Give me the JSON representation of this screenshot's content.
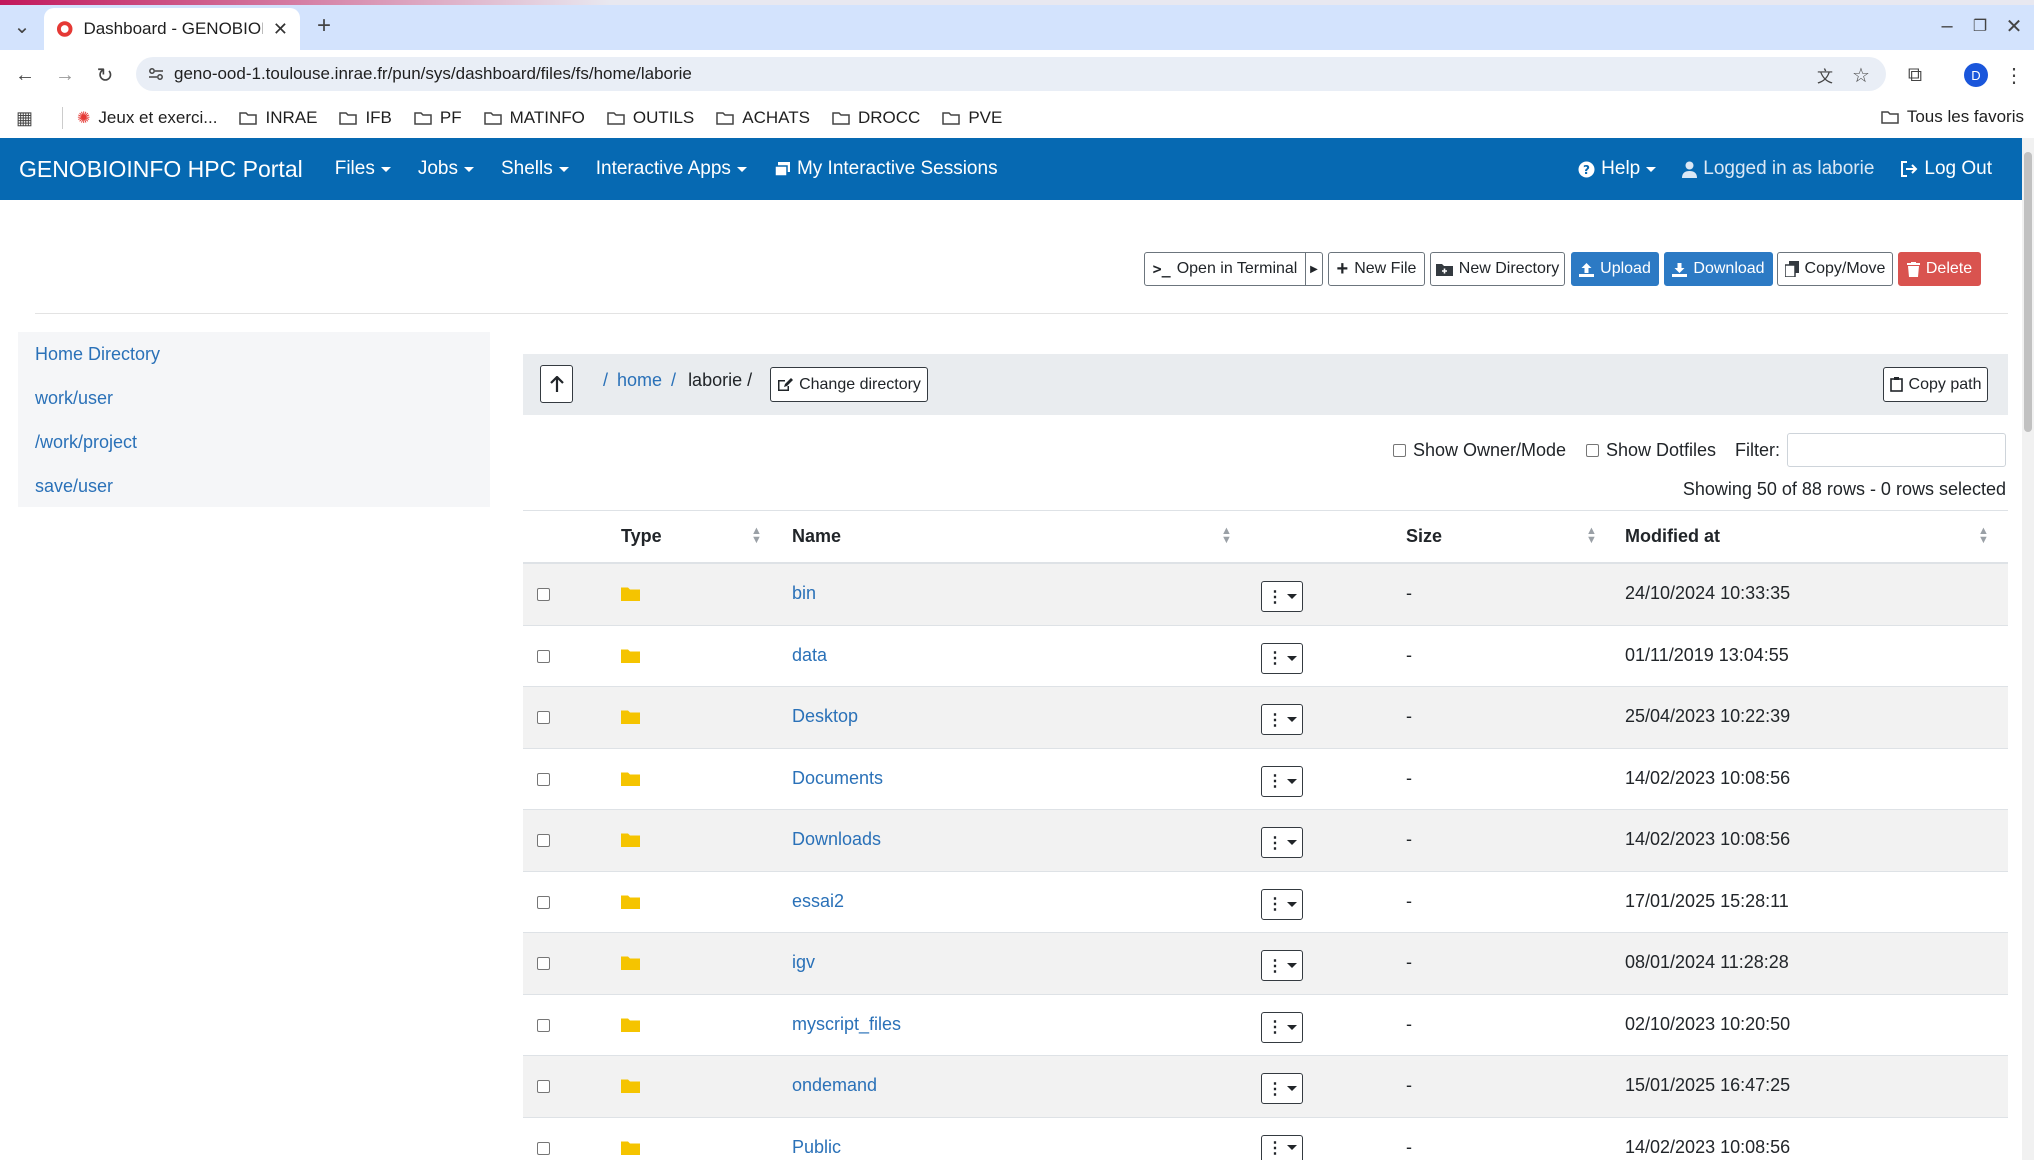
{
  "browser": {
    "tab_title": "Dashboard - GENOBIOINFO",
    "url": "geno-ood-1.toulouse.inrae.fr/pun/sys/dashboard/files/fs/home/laborie",
    "profile_initial": "D",
    "bookmarks": [
      "Jeux et exerci...",
      "INRAE",
      "IFB",
      "PF",
      "MATINFO",
      "OUTILS",
      "ACHATS",
      "DROCC",
      "PVE"
    ],
    "all_bookmarks": "Tous les favoris"
  },
  "navbar": {
    "brand": "GENOBIOINFO HPC Portal",
    "files": "Files",
    "jobs": "Jobs",
    "shells": "Shells",
    "interactive_apps": "Interactive Apps",
    "sessions": "My Interactive Sessions",
    "help": "Help",
    "logged_in": "Logged in as laborie",
    "logout": "Log Out"
  },
  "toolbar": {
    "open_terminal": "Open in Terminal",
    "new_file": "New File",
    "new_directory": "New Directory",
    "upload": "Upload",
    "download": "Download",
    "copy_move": "Copy/Move",
    "delete": "Delete"
  },
  "sidebar": {
    "items": [
      "Home Directory",
      "work/user",
      "/work/project",
      "save/user"
    ]
  },
  "breadcrumb": {
    "sep": "/",
    "home": "home",
    "current": "laborie /",
    "change_dir": "Change directory",
    "copy_path": "Copy path"
  },
  "controls": {
    "show_owner": "Show Owner/Mode",
    "show_dotfiles": "Show Dotfiles",
    "filter_label": "Filter:",
    "filter_value": "",
    "summary": "Showing 50 of 88 rows - 0 rows selected"
  },
  "table": {
    "headers": {
      "type": "Type",
      "name": "Name",
      "size": "Size",
      "modified": "Modified at"
    },
    "rows": [
      {
        "name": "bin",
        "size": "-",
        "modified": "24/10/2024 10:33:35"
      },
      {
        "name": "data",
        "size": "-",
        "modified": "01/11/2019 13:04:55"
      },
      {
        "name": "Desktop",
        "size": "-",
        "modified": "25/04/2023 10:22:39"
      },
      {
        "name": "Documents",
        "size": "-",
        "modified": "14/02/2023 10:08:56"
      },
      {
        "name": "Downloads",
        "size": "-",
        "modified": "14/02/2023 10:08:56"
      },
      {
        "name": "essai2",
        "size": "-",
        "modified": "17/01/2025 15:28:11"
      },
      {
        "name": "igv",
        "size": "-",
        "modified": "08/01/2024 11:28:28"
      },
      {
        "name": "myscript_files",
        "size": "-",
        "modified": "02/10/2023 10:20:50"
      },
      {
        "name": "ondemand",
        "size": "-",
        "modified": "15/01/2025 16:47:25"
      },
      {
        "name": "Public",
        "size": "-",
        "modified": "14/02/2023 10:08:56"
      }
    ]
  },
  "colors": {
    "navbar": "#0669b2",
    "link": "#2a71b8",
    "primary": "#2c7ac4",
    "danger": "#d9534f",
    "folder": "#f5c400"
  }
}
